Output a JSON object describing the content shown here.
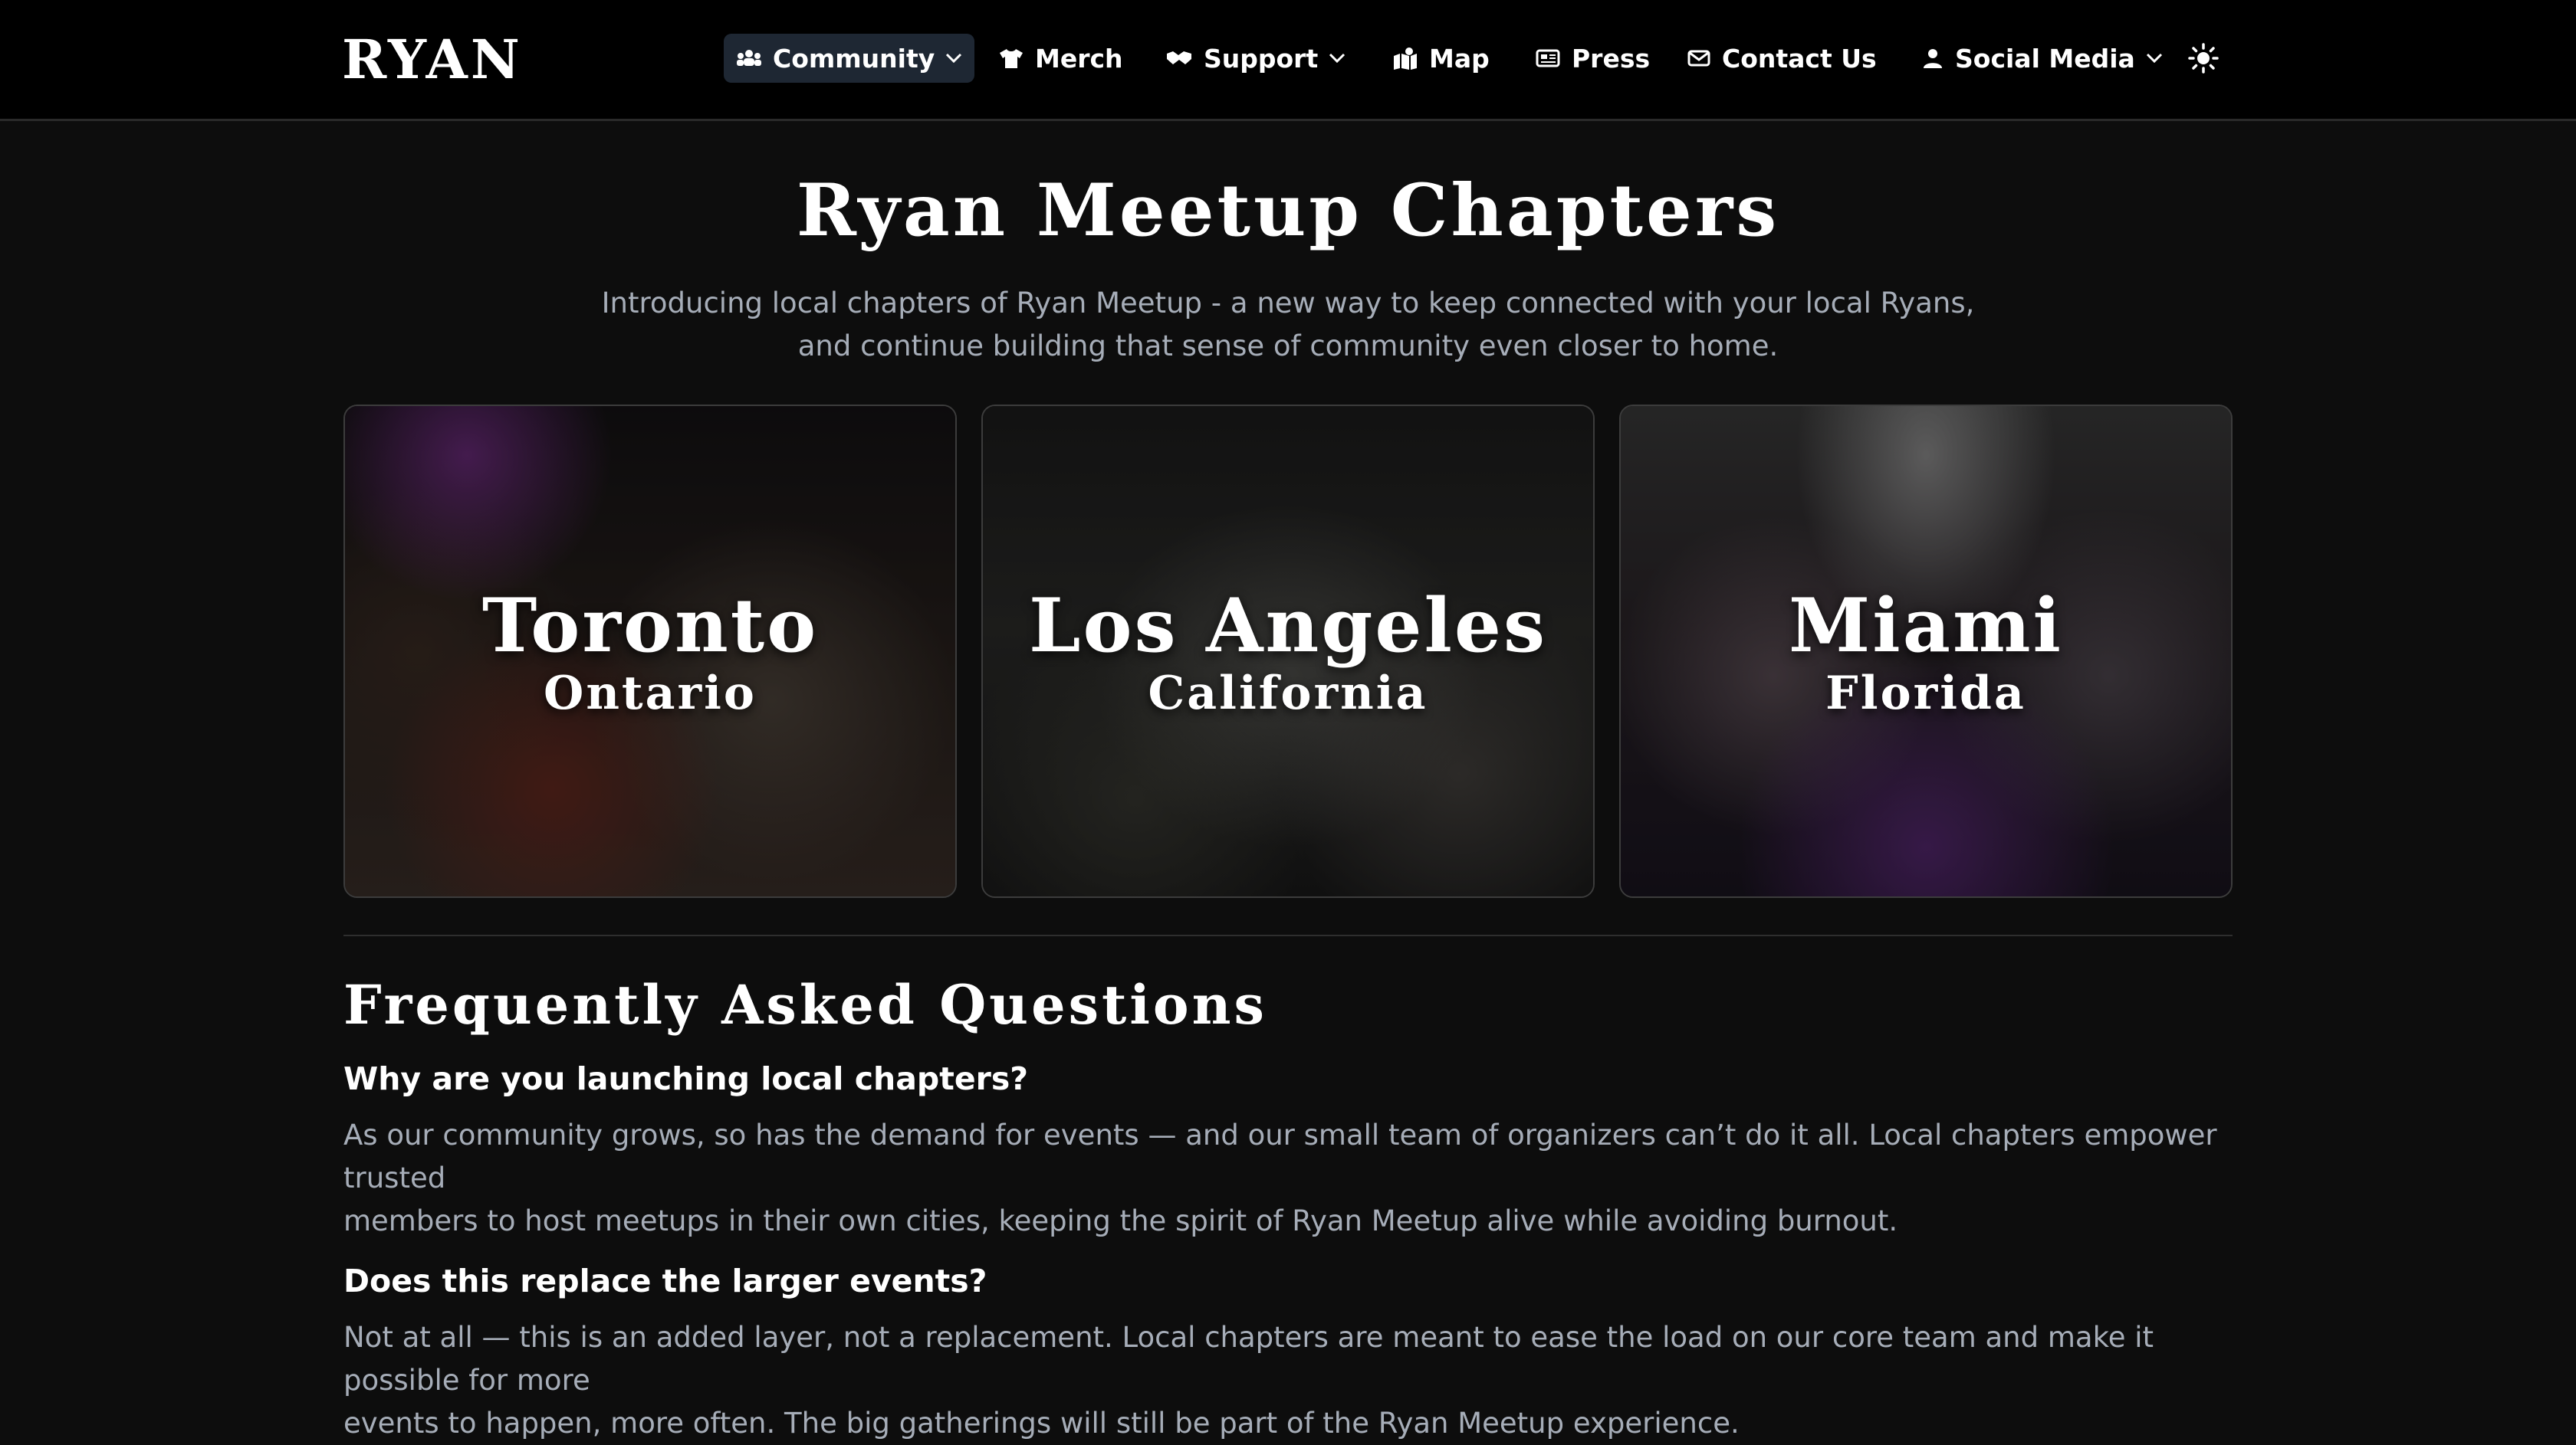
{
  "header": {
    "logo": "RYAN",
    "nav": [
      {
        "label": "Community",
        "icon": "people-group-icon",
        "dropdown": true,
        "active": true
      },
      {
        "label": "Merch",
        "icon": "tshirt-icon",
        "dropdown": false
      },
      {
        "label": "Support",
        "icon": "handshake-icon",
        "dropdown": true
      },
      {
        "label": "Map",
        "icon": "map-icon",
        "dropdown": false
      },
      {
        "label": "Press",
        "icon": "newspaper-icon",
        "dropdown": false
      },
      {
        "label": "Contact Us",
        "icon": "envelope-icon",
        "dropdown": false
      },
      {
        "label": "Social Media",
        "icon": "user-icon",
        "dropdown": true
      }
    ],
    "theme_toggle_icon": "sun-icon"
  },
  "hero": {
    "title": "Ryan Meetup Chapters",
    "intro_line1": "Introducing local chapters of Ryan Meetup - a new way to keep connected with your local Ryans,",
    "intro_line2": "and continue building that sense of community even closer to home."
  },
  "chapters": [
    {
      "city": "Toronto",
      "region": "Ontario"
    },
    {
      "city": "Los Angeles",
      "region": "California"
    },
    {
      "city": "Miami",
      "region": "Florida"
    }
  ],
  "faq": {
    "title": "Frequently Asked Questions",
    "items": [
      {
        "question": "Why are you launching local chapters?",
        "answer_line1": "As our community grows, so has the demand for events — and our small team of organizers can’t do it all. Local chapters empower trusted",
        "answer_line2": "members to host meetups in their own cities, keeping the spirit of Ryan Meetup alive while avoiding burnout."
      },
      {
        "question": "Does this replace the larger events?",
        "answer_line1": "Not at all — this is an added layer, not a replacement. Local chapters are meant to ease the load on our core team and make it possible for more",
        "answer_line2": "events to happen, more often. The big gatherings will still be part of the Ryan Meetup experience."
      }
    ]
  },
  "colors": {
    "background": "#0d0d0d",
    "nav_background": "#000000",
    "active_nav": "#1e2733",
    "muted_text": "#a6adb8"
  }
}
